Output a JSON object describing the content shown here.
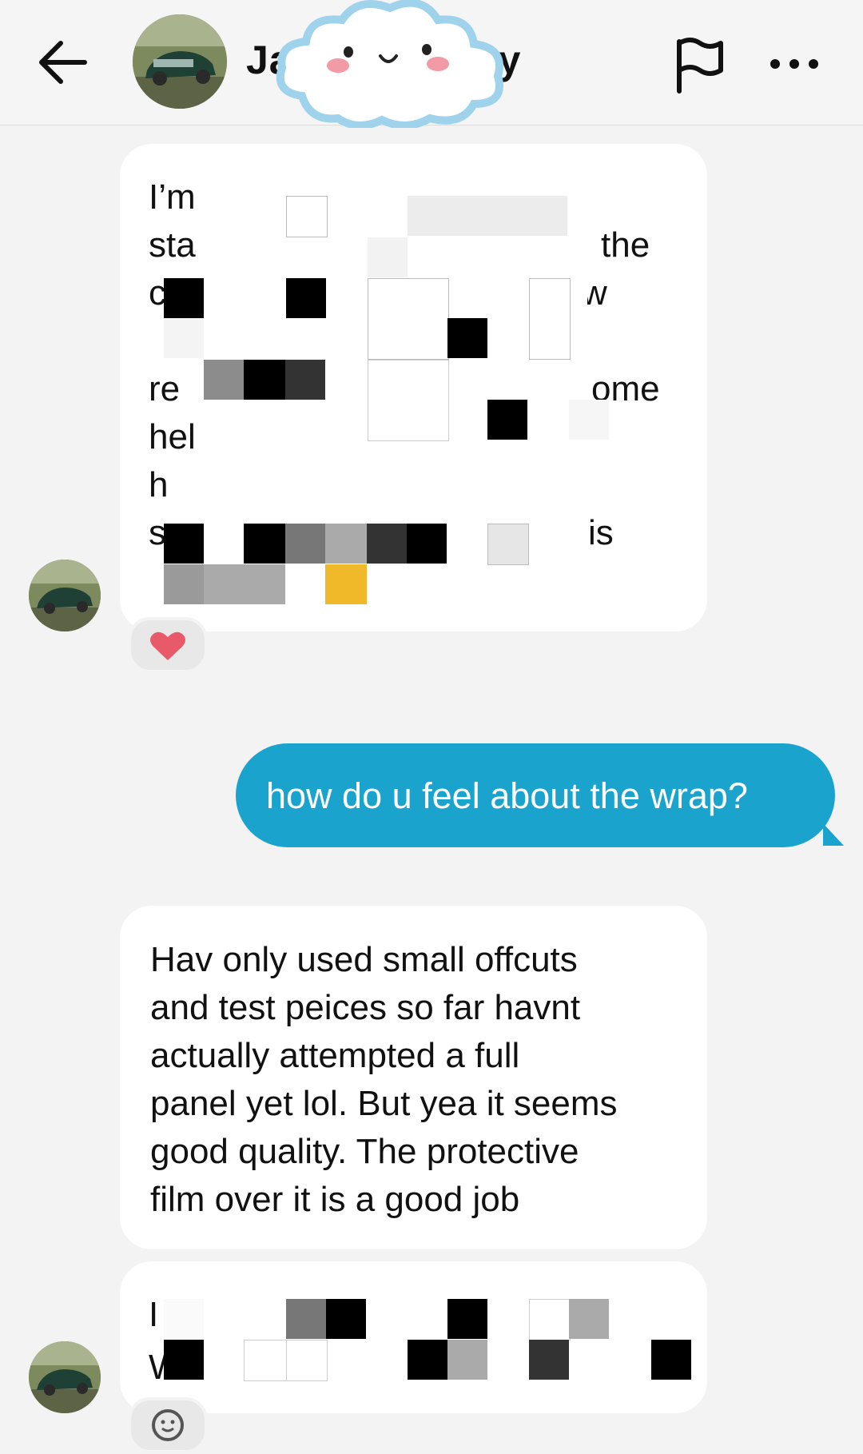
{
  "header": {
    "contact_name_left": "Ja",
    "contact_name_right": "y",
    "icons": {
      "back": "arrow-left-icon",
      "flag": "flag-icon",
      "more": "more-horizontal-icon"
    }
  },
  "messages": [
    {
      "direction": "incoming",
      "fragments": [
        "I’m",
        "sta",
        "the",
        "ca",
        "w",
        "d",
        "re",
        "ome",
        "hel",
        "h",
        "so",
        "is"
      ],
      "reaction": "heart"
    },
    {
      "direction": "outgoing",
      "text": "how do u feel about the wrap?"
    },
    {
      "direction": "incoming",
      "text": "Hav only used small offcuts\nand test peices so far havnt\nactually attempted a full\npanel yet lol. But yea it seems\ngood quality. The protective\nfilm over it is a good job"
    },
    {
      "direction": "incoming",
      "fragments": [
        "I",
        "W"
      ],
      "reaction": "smiley"
    }
  ],
  "colors": {
    "outgoing_bubble": "#1aa3cd",
    "incoming_bubble": "#ffffff",
    "background": "#f3f3f3",
    "heart": "#e85a6a",
    "pixel_accent": "#f0b92a"
  }
}
